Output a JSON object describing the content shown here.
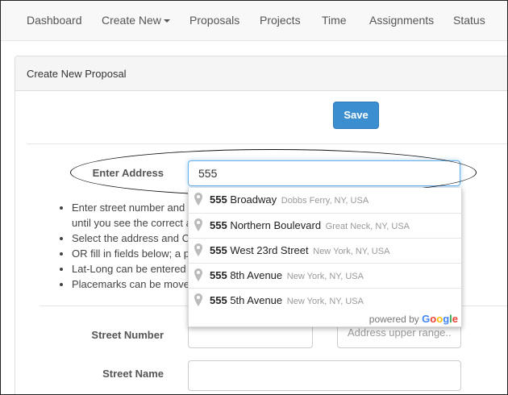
{
  "nav": {
    "items": [
      {
        "label": "Dashboard"
      },
      {
        "label": "Create New"
      },
      {
        "label": "Proposals"
      },
      {
        "label": "Projects"
      },
      {
        "label": "Time"
      },
      {
        "label": "Assignments"
      },
      {
        "label": "Status"
      }
    ]
  },
  "panel": {
    "title": "Create New Proposal",
    "save_label": "Save"
  },
  "address": {
    "label": "Enter Address",
    "value": "555"
  },
  "instructions": [
    "Enter street number and",
    "until you see the correct a",
    "Select the address and C",
    "OR fill in fields below; a p",
    "Lat-Long can be entered",
    "Placemarks can be move"
  ],
  "autocomplete": {
    "items": [
      {
        "match": "555",
        "main": " Broadway",
        "secondary": "Dobbs Ferry, NY, USA"
      },
      {
        "match": "555",
        "main": " Northern Boulevard",
        "secondary": "Great Neck, NY, USA"
      },
      {
        "match": "555",
        "main": " West 23rd Street",
        "secondary": "New York, NY, USA"
      },
      {
        "match": "555",
        "main": " 8th Avenue",
        "secondary": "New York, NY, USA"
      },
      {
        "match": "555",
        "main": " 5th Avenue",
        "secondary": "New York, NY, USA"
      }
    ],
    "powered_by": "powered by",
    "google_logo": [
      "G",
      "o",
      "o",
      "g",
      "l",
      "e"
    ],
    "google_colors": [
      "#4285F4",
      "#EA4335",
      "#FBBC05",
      "#4285F4",
      "#34A853",
      "#EA4335"
    ]
  },
  "fields": {
    "street_number_label": "Street Number",
    "street_name_label": "Street Name",
    "address_upper_placeholder": "Address upper range.."
  }
}
